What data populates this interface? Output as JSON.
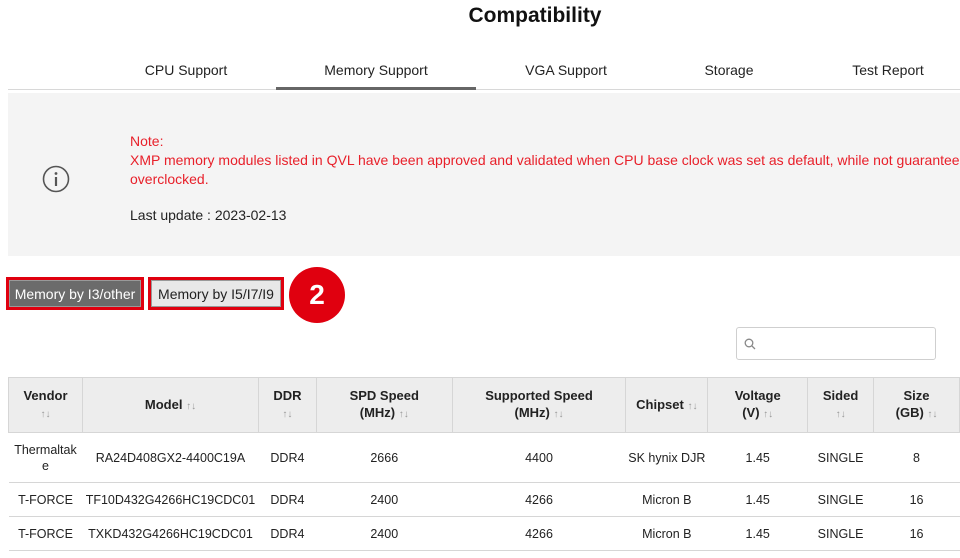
{
  "page": {
    "title": "Compatibility"
  },
  "tabs": [
    {
      "label": "CPU Support",
      "active": false
    },
    {
      "label": "Memory Support",
      "active": true
    },
    {
      "label": "VGA Support",
      "active": false
    },
    {
      "label": "Storage",
      "active": false
    },
    {
      "label": "Test Report",
      "active": false
    }
  ],
  "note": {
    "heading": "Note:",
    "body": "XMP memory modules listed in QVL have been approved and validated when CPU base clock was set as default, while not guaranteed overclocked.",
    "last_update": "Last update : 2023-02-13",
    "icon": "info-icon"
  },
  "memory_buttons": {
    "i3_label": "Memory by I3/other",
    "i5_label": "Memory by I5/I7/I9"
  },
  "step_badge": "2",
  "search": {
    "placeholder": "",
    "value": "",
    "icon": "search-icon"
  },
  "table": {
    "headers": {
      "vendor": "Vendor",
      "model": "Model",
      "ddr": "DDR",
      "spd_line1": "SPD Speed",
      "spd_line2": "(MHz)",
      "supported_line1": "Supported Speed",
      "supported_line2": "(MHz)",
      "chipset": "Chipset",
      "voltage_line1": "Voltage",
      "voltage_line2": "(V)",
      "sided": "Sided",
      "size_line1": "Size",
      "size_line2": "(GB)"
    },
    "sort_glyph": "↑↓",
    "rows": [
      {
        "vendor": "Thermaltake",
        "model": "RA24D408GX2-4400C19A",
        "ddr": "DDR4",
        "spd": "2666",
        "supported": "4400",
        "chipset": "SK hynix DJR",
        "voltage": "1.45",
        "sided": "SINGLE",
        "size": "8"
      },
      {
        "vendor": "T-FORCE",
        "model": "TF10D432G4266HC19CDC01",
        "ddr": "DDR4",
        "spd": "2400",
        "supported": "4266",
        "chipset": "Micron B",
        "voltage": "1.45",
        "sided": "SINGLE",
        "size": "16"
      },
      {
        "vendor": "T-FORCE",
        "model": "TXKD432G4266HC19CDC01",
        "ddr": "DDR4",
        "spd": "2400",
        "supported": "4266",
        "chipset": "Micron B",
        "voltage": "1.45",
        "sided": "SINGLE",
        "size": "16"
      }
    ]
  },
  "colors": {
    "note_red": "#e8202a",
    "highlight_red": "#e0000f",
    "active_button": "#6b6b6b"
  }
}
